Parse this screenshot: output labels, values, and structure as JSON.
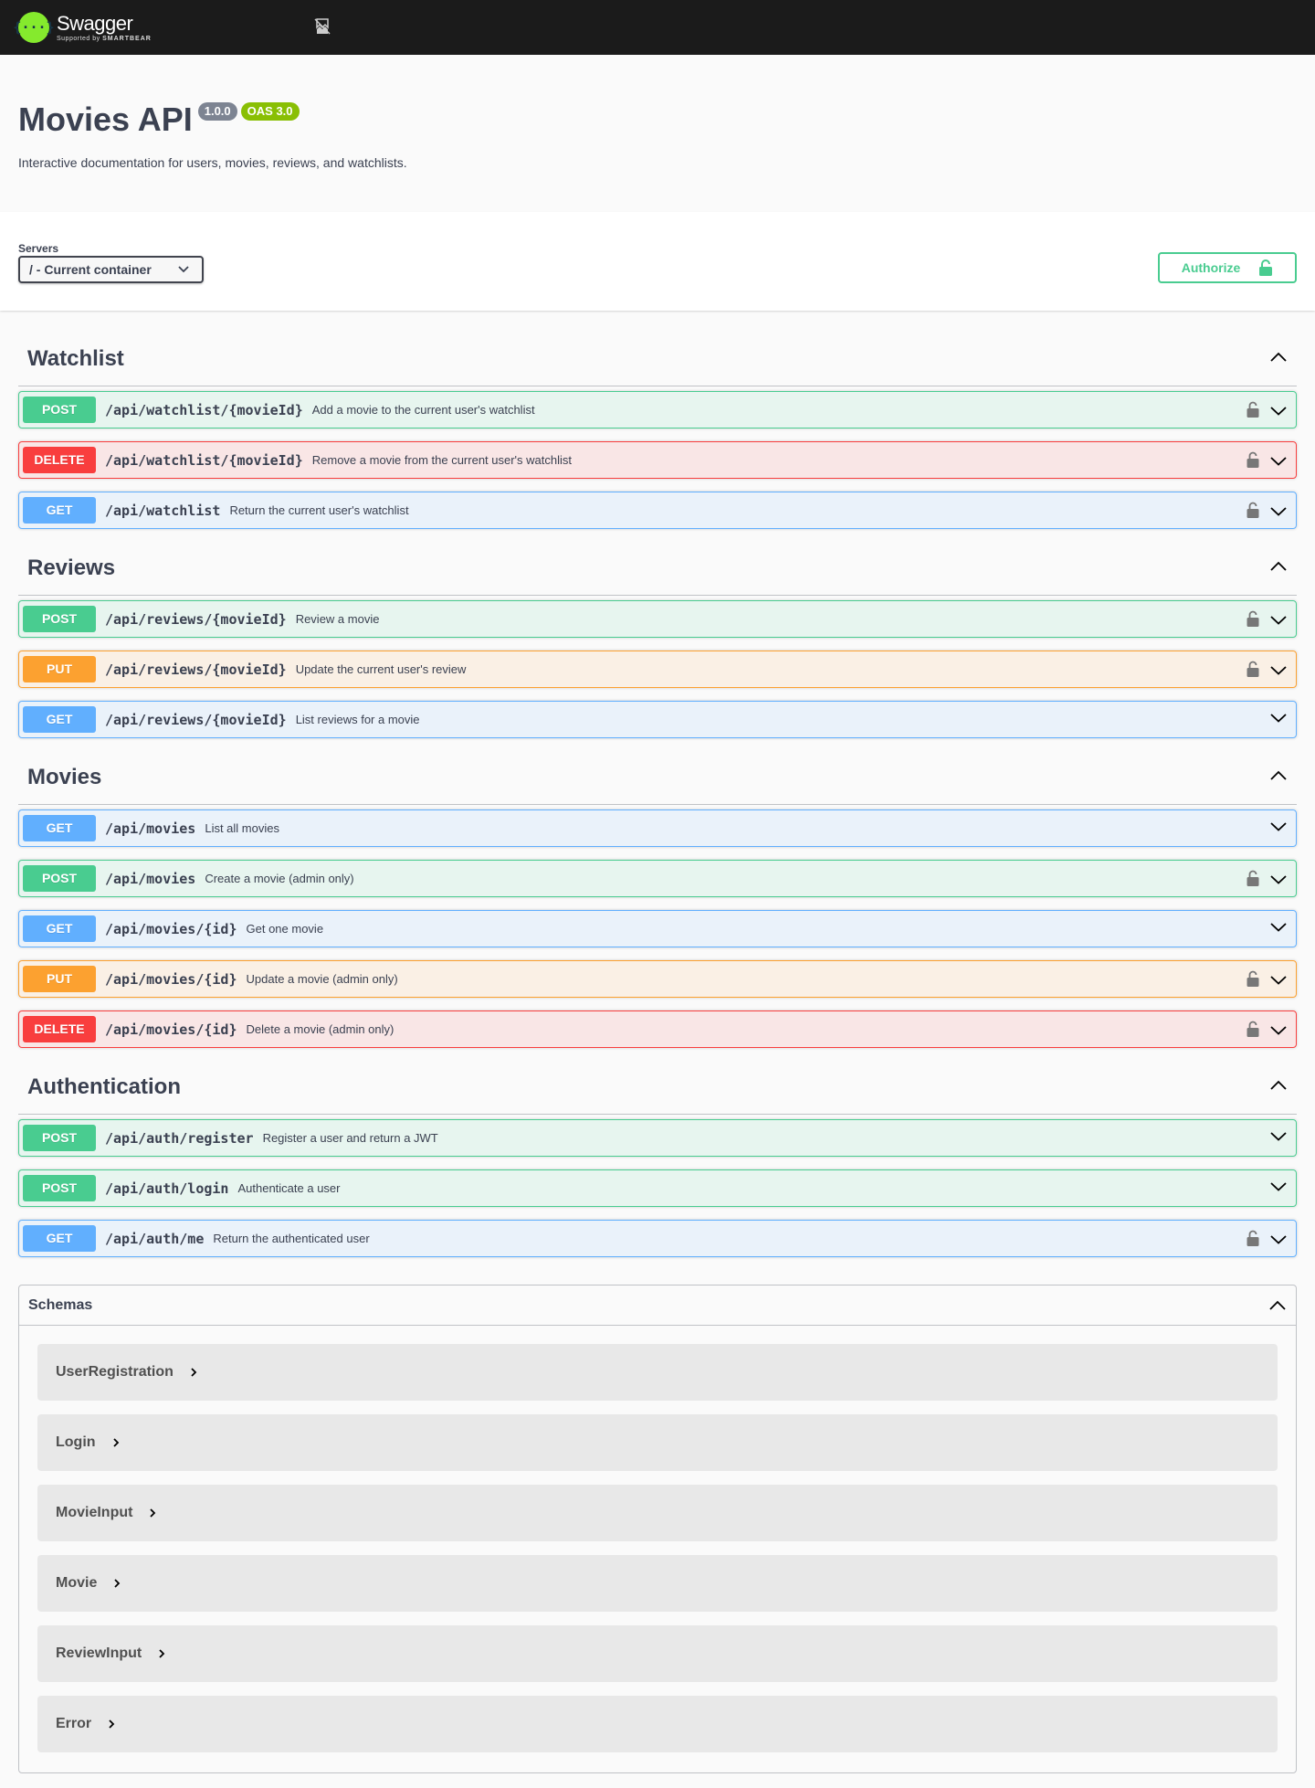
{
  "topbar": {
    "brand": "Swagger",
    "sub_prefix": "Supported by",
    "sub_brand": "SMARTBEAR"
  },
  "info": {
    "title": "Movies API",
    "version": "1.0.0",
    "oas": "OAS 3.0",
    "description": "Interactive documentation for users, movies, reviews, and watchlists."
  },
  "servers": {
    "label": "Servers",
    "selected": "/ - Current container"
  },
  "authorize": {
    "label": "Authorize"
  },
  "tags": [
    {
      "name": "Watchlist",
      "ops": [
        {
          "method": "POST",
          "path": "/api/watchlist/{movieId}",
          "summary": "Add a movie to the current user's watchlist",
          "locked": true
        },
        {
          "method": "DELETE",
          "path": "/api/watchlist/{movieId}",
          "summary": "Remove a movie from the current user's watchlist",
          "locked": true
        },
        {
          "method": "GET",
          "path": "/api/watchlist",
          "summary": "Return the current user's watchlist",
          "locked": true
        }
      ]
    },
    {
      "name": "Reviews",
      "ops": [
        {
          "method": "POST",
          "path": "/api/reviews/{movieId}",
          "summary": "Review a movie",
          "locked": true
        },
        {
          "method": "PUT",
          "path": "/api/reviews/{movieId}",
          "summary": "Update the current user's review",
          "locked": true
        },
        {
          "method": "GET",
          "path": "/api/reviews/{movieId}",
          "summary": "List reviews for a movie",
          "locked": false
        }
      ]
    },
    {
      "name": "Movies",
      "ops": [
        {
          "method": "GET",
          "path": "/api/movies",
          "summary": "List all movies",
          "locked": false
        },
        {
          "method": "POST",
          "path": "/api/movies",
          "summary": "Create a movie (admin only)",
          "locked": true
        },
        {
          "method": "GET",
          "path": "/api/movies/{id}",
          "summary": "Get one movie",
          "locked": false
        },
        {
          "method": "PUT",
          "path": "/api/movies/{id}",
          "summary": "Update a movie (admin only)",
          "locked": true
        },
        {
          "method": "DELETE",
          "path": "/api/movies/{id}",
          "summary": "Delete a movie (admin only)",
          "locked": true
        }
      ]
    },
    {
      "name": "Authentication",
      "ops": [
        {
          "method": "POST",
          "path": "/api/auth/register",
          "summary": "Register a user and return a JWT",
          "locked": false
        },
        {
          "method": "POST",
          "path": "/api/auth/login",
          "summary": "Authenticate a user",
          "locked": false
        },
        {
          "method": "GET",
          "path": "/api/auth/me",
          "summary": "Return the authenticated user",
          "locked": true
        }
      ]
    }
  ],
  "schemas": {
    "title": "Schemas",
    "items": [
      "UserRegistration",
      "Login",
      "MovieInput",
      "Movie",
      "ReviewInput",
      "Error"
    ]
  },
  "colors": {
    "post": "#49cc90",
    "get": "#61affe",
    "put": "#fca130",
    "delete": "#f93e3e",
    "topbar": "#1b1b1b",
    "logo": "#85ea2d"
  }
}
